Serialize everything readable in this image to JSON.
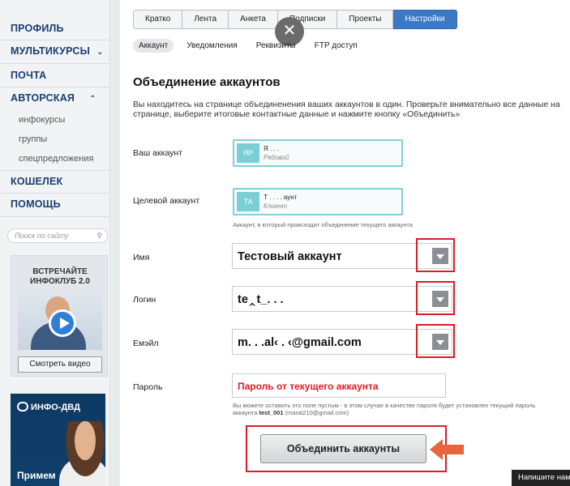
{
  "sidebar": {
    "items": [
      {
        "label": "ПРОФИЛЬ"
      },
      {
        "label": "МУЛЬТИКУРСЫ"
      },
      {
        "label": "ПОЧТА"
      },
      {
        "label": "АВТОРСКАЯ"
      }
    ],
    "subitems": [
      "инфокурсы",
      "группы",
      "спецпредложения"
    ],
    "items2": [
      {
        "label": "КОШЕЛЕК"
      },
      {
        "label": "ПОМОЩЬ"
      }
    ],
    "search_placeholder": "Поиск по сайту",
    "promo": {
      "title": "ВСТРЕЧАЙТЕ ИНФОКЛУБ 2.0",
      "button": "Смотреть видео"
    },
    "ad": {
      "logo": "ИНФО-ДВД",
      "text": "Примем"
    }
  },
  "tabs": [
    "Кратко",
    "Лента",
    "Анкета",
    "Подписки",
    "Проекты",
    "Настройки"
  ],
  "active_tab": "Настройки",
  "subtabs": [
    "Аккаунт",
    "Уведомления",
    "Реквизиты",
    "FTP доступ"
  ],
  "active_subtab": "Аккаунт",
  "page": {
    "title": "Объединение аккаунтов",
    "description": "Вы находитесь на странице объединенения ваших аккаунтов в один. Проверьте внимательно все данные на странице, выберите итоговые контактные данные и нажмите кнопку «Объединить»"
  },
  "form": {
    "your_account": {
      "label": "Ваш аккаунт",
      "initials": "ЯР",
      "name": "Я  .  .   .",
      "role": "Рядовой"
    },
    "target_account": {
      "label": "Целевой аккаунт",
      "initials": "ТА",
      "name": "Т  .   .   .  .  аунт",
      "role": "Клиент",
      "hint": "Аккаунт, в который происходит объединение текущего аккаунта"
    },
    "name": {
      "label": "Имя",
      "value": "Тестовый аккаунт"
    },
    "login": {
      "label": "Логин",
      "value": "te‸t_.  .  ."
    },
    "email": {
      "label": "Емэйл",
      "value": "m.  .  .al‹ .  ‹@gmail.com"
    },
    "password": {
      "label": "Пароль",
      "value": "Пароль от текущего аккаунта",
      "hint_before": "Вы можете оставить это поле пустым - в этом случае в качестве пароля будет установлен текущий пароль аккаунта",
      "hint_login": "test_001",
      "hint_after": "(marat210@gmail.com)"
    },
    "submit": "Объединить аккаунты"
  },
  "chat": "Напишите нам",
  "colors": {
    "accent": "#3b79c4",
    "highlight": "#e01b24",
    "arrow": "#e8643c",
    "account_border": "#7fd1dc"
  }
}
